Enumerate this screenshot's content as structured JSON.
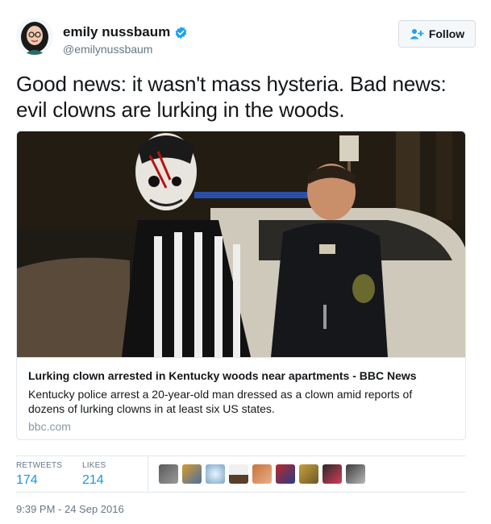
{
  "user": {
    "display_name": "emily nussbaum",
    "handle": "@emilynussbaum",
    "verified": true
  },
  "follow_button": {
    "label": "Follow"
  },
  "tweet": {
    "text": "Good news: it wasn't mass hysteria. Bad news: evil clowns are lurking in the woods."
  },
  "card": {
    "title": "Lurking clown arrested in Kentucky woods near apartments - BBC News",
    "description": "Kentucky police arrest a 20-year-old man dressed as a clown amid reports of dozens of lurking clowns in at least six US states.",
    "domain": "bbc.com"
  },
  "stats": {
    "retweets_label": "RETWEETS",
    "retweets_count": "174",
    "likes_label": "LIKES",
    "likes_count": "214"
  },
  "timestamp": "9:39 PM - 24 Sep 2016",
  "colors": {
    "link_blue": "#1b95e0",
    "verified_blue": "#1da1f2",
    "secondary_text": "#657786"
  }
}
